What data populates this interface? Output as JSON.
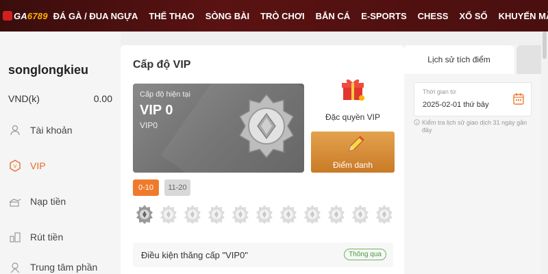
{
  "brand": {
    "logo_prefix": "GA",
    "logo_suffix": "6789"
  },
  "nav": {
    "items": [
      "Đá gà / đua ngựa",
      "Thể thao",
      "Sòng bài",
      "Trò chơi",
      "Bắn cá",
      "E-Sports",
      "Chess",
      "Xổ số",
      "Khuyến mãi"
    ]
  },
  "user": {
    "name": "songlongkieu",
    "currency": "VND(k)",
    "balance": "0.00"
  },
  "sidebar": {
    "items": [
      {
        "label": "Tài khoản",
        "icon": "user-icon"
      },
      {
        "label": "VIP",
        "icon": "vip-icon",
        "active": true
      },
      {
        "label": "Nạp tiền",
        "icon": "deposit-icon"
      },
      {
        "label": "Rút tiền",
        "icon": "withdraw-icon"
      },
      {
        "label": "Trung tâm phần",
        "icon": "center-icon"
      }
    ]
  },
  "main": {
    "title": "Cấp độ VIP",
    "vip_card": {
      "sub": "Cấp độ hiện tại",
      "level": "VIP 0",
      "code": "VIP0"
    },
    "privilege_label": "Đặc quyền VIP",
    "checkin_label": "Điểm danh",
    "range_tabs": [
      "0-10",
      "11-20"
    ],
    "condition": {
      "text": "Điều kiện thăng cấp \"VIP0\"",
      "status": "Thông qua"
    }
  },
  "right": {
    "tab_history": "Lịch sử tích điểm",
    "date_label": "Thời gian từ",
    "date_value": "2025-02-01 thứ bảy",
    "note": "Kiểm tra lịch sử giao dịch 31 ngày gần đây"
  },
  "colors": {
    "accent": "#e86d2a",
    "header_bg": "#4a0f0f",
    "pass_green": "#4a9a3e"
  }
}
